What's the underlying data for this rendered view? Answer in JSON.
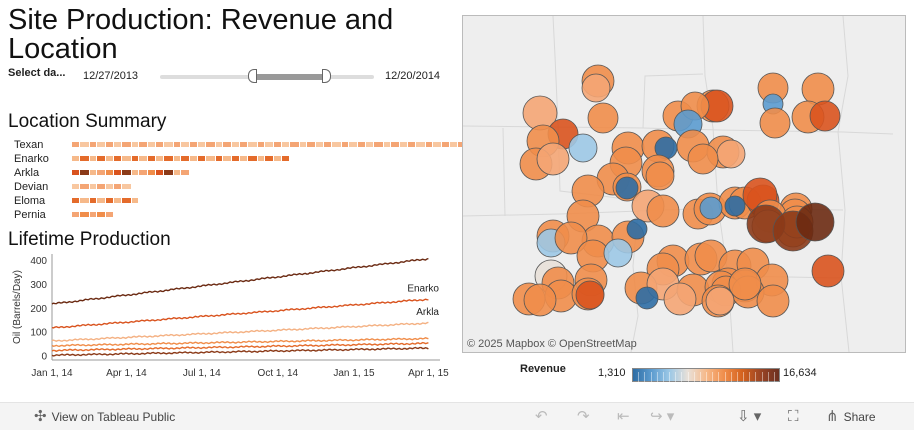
{
  "title": "Site Production: Revenue and Location",
  "filter": {
    "label": "Select da...",
    "start_date": "12/27/2013",
    "end_date": "12/20/2014"
  },
  "location_summary": {
    "heading": "Location Summary",
    "locations": [
      {
        "name": "Texan",
        "segments": 50
      },
      {
        "name": "Enarko",
        "segments": 26
      },
      {
        "name": "Arkla",
        "segments": 14
      },
      {
        "name": "Devian",
        "segments": 7
      },
      {
        "name": "Eloma",
        "segments": 8
      },
      {
        "name": "Pernia",
        "segments": 5
      }
    ]
  },
  "lifetime_production": {
    "heading": "Lifetime Production"
  },
  "chart_data": {
    "type": "line",
    "ylabel": "Oil (Barrels/Day)",
    "x_ticks": [
      "Jan 1, 14",
      "Apr 1, 14",
      "Jul 1, 14",
      "Oct 1, 14",
      "Jan 1, 15",
      "Apr 1, 15"
    ],
    "x_range": [
      "2014-01-01",
      "2015-04-15"
    ],
    "y_ticks": [
      0,
      100,
      200,
      300,
      400
    ],
    "ylim": [
      -15,
      430
    ],
    "series": [
      {
        "name": "Texan",
        "label": "",
        "color": "#6b2a12",
        "start": 220,
        "end": 410
      },
      {
        "name": "Enarko",
        "label": "Enarko",
        "color": "#d9531e",
        "start": 120,
        "end": 240
      },
      {
        "name": "Arkla",
        "label": "Arkla",
        "color": "#f4b183",
        "start": 65,
        "end": 140
      },
      {
        "name": "Devian",
        "label": "",
        "color": "#f08d4a",
        "start": 45,
        "end": 75
      },
      {
        "name": "Eloma",
        "label": "",
        "color": "#e46b2b",
        "start": 25,
        "end": 55
      },
      {
        "name": "Pernia",
        "label": "",
        "color": "#8b3a18",
        "start": 5,
        "end": 35
      }
    ]
  },
  "map": {
    "attribution": "© 2025 Mapbox  © OpenStreetMap"
  },
  "legend": {
    "title": "Revenue",
    "min": "1,310",
    "max": "16,634"
  },
  "toolbar": {
    "view_label": "View on Tableau Public",
    "share_label": "Share"
  },
  "colors": {
    "accent": "#f08d4a",
    "dark": "#6b2a12",
    "cool": "#3a7fb5"
  }
}
